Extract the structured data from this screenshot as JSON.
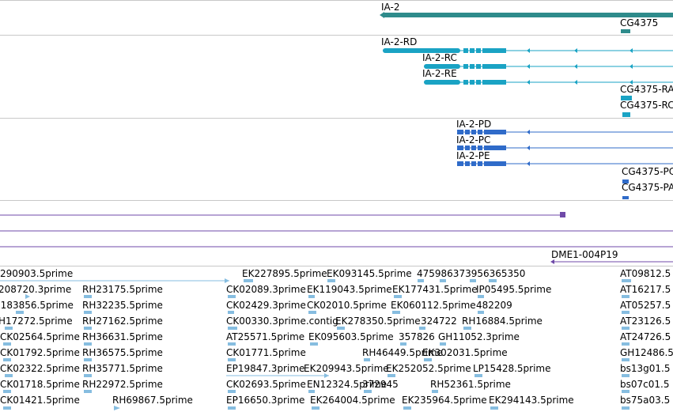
{
  "colors": {
    "gene": "#2e8b8b",
    "transcript_rna": "#1aa3c4",
    "protein": "#2f6bc9",
    "insertion": "#6f4aa8",
    "est": "#86bde0"
  },
  "gene_track": {
    "labels": [
      "IA-2",
      "CG4375"
    ]
  },
  "rna_track": {
    "labels": [
      "IA-2-RD",
      "IA-2-RC",
      "IA-2-RE",
      "CG4375-RA",
      "CG4375-RC"
    ]
  },
  "protein_track": {
    "labels": [
      "IA-2-PD",
      "IA-2-PC",
      "IA-2-PE",
      "CG4375-PC",
      "CG4375-PA"
    ]
  },
  "insertion_track": {
    "labels": [
      "DME1-004P19"
    ]
  },
  "est_track": {
    "labels": [
      "290903.5prime",
      "EK227895.5prime",
      "EK093145.5prime",
      "475986373956365350",
      "AT09812.5",
      "208720.3prime",
      "RH23175.5prime",
      "CK02089.3prime",
      "EK119043.5prime",
      "EK177431.5prime",
      "IP05495.5prime",
      "AT16217.5",
      "(183856.5prime",
      "RH32235.5prime",
      "CK02429.3prime",
      "CK02010.5prime",
      "EK060112.5prime",
      "482209",
      "AT05257.5",
      "H17272.5prime",
      "RH27162.5prime",
      "CK00330.3prime.contig",
      "EK278350.5prime",
      "324722",
      "RH16884.5prime",
      "AT23126.5",
      "CK02564.5prime",
      "RH36631.5prime",
      "AT25571.5prime",
      "EK095603.5prime",
      "357826",
      "GH11052.3prime",
      "AT24726.5",
      "CK01792.5prime",
      "RH36575.5prime",
      "CK01771.5prime",
      "RH46449.5prime",
      "EK302031.5prime",
      "GH12486.5",
      "CK02322.5prime",
      "RH35771.5prime",
      "EP19847.3prime",
      "EK209943.5prime",
      "EK252052.5prime",
      "LP15428.5prime",
      "bs13g01.5",
      "CK01718.5prime",
      "RH22972.5prime",
      "CK02693.5prime",
      "EN12324.5prime",
      "372945",
      "RH52361.5prime",
      "bs07c01.5",
      "CK01421.5prime",
      "RH69867.5prime",
      "EP16650.3prime",
      "EK264004.5prime",
      "EK235964.5prime",
      "EK294143.5prime",
      "bs75a03.5"
    ]
  }
}
